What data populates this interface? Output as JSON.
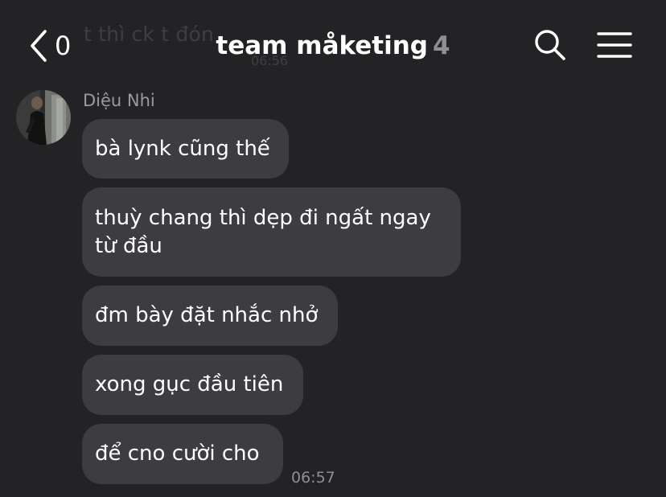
{
  "header": {
    "back_count": "0",
    "title": "team måketing",
    "member_count": "4",
    "icons": {
      "back": "chevron-left-icon",
      "search": "search-icon",
      "menu": "hamburger-menu-icon"
    }
  },
  "background_message": {
    "text": "t thì ck t đón",
    "time": "06:56"
  },
  "conversation": {
    "sender": "Diệu Nhi",
    "messages": [
      {
        "text": "bà lynk cũng thế"
      },
      {
        "text": "thuỳ chang thì dẹp đi ngất ngay\ntừ đầu"
      },
      {
        "text": "đm bày đặt nhắc nhở"
      },
      {
        "text": "xong gục đầu tiên"
      },
      {
        "text": "để cno cười cho"
      }
    ],
    "last_time": "06:57"
  },
  "colors": {
    "background": "#232326",
    "bubble": "#3d3d41",
    "muted_text": "#8e8e93"
  }
}
